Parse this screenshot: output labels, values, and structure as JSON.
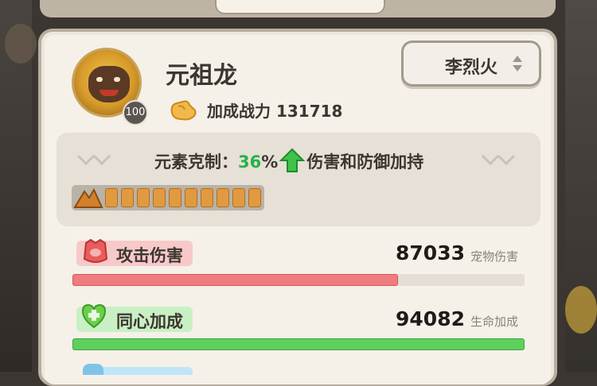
{
  "pet": {
    "name": "元祖龙",
    "level": "100",
    "power_label": "加成战力 131718"
  },
  "owner": {
    "selected": "李烈火"
  },
  "element": {
    "prefix": "元素克制：",
    "percent": "36",
    "percent_sign": "%",
    "suffix": "伤害和防御加持",
    "segments_total": 10,
    "segments_filled": 10
  },
  "stats": {
    "attack": {
      "label": "攻击伤害",
      "value": "87033",
      "unit": "宠物伤害",
      "fill_fraction": 0.72,
      "color": "#f07d7d"
    },
    "heart": {
      "label": "同心加成",
      "value": "94082",
      "unit": "生命加成",
      "fill_fraction": 1.0,
      "color": "#5fcf5f"
    }
  },
  "colors": {
    "accent_green": "#27b14a",
    "attack_tag": "#f7c9c9",
    "heart_tag": "#c9f0c4"
  },
  "icons": [
    "power-arm-icon",
    "fire-icon",
    "heart-icon",
    "attack-icon",
    "up-arrow-icon"
  ]
}
